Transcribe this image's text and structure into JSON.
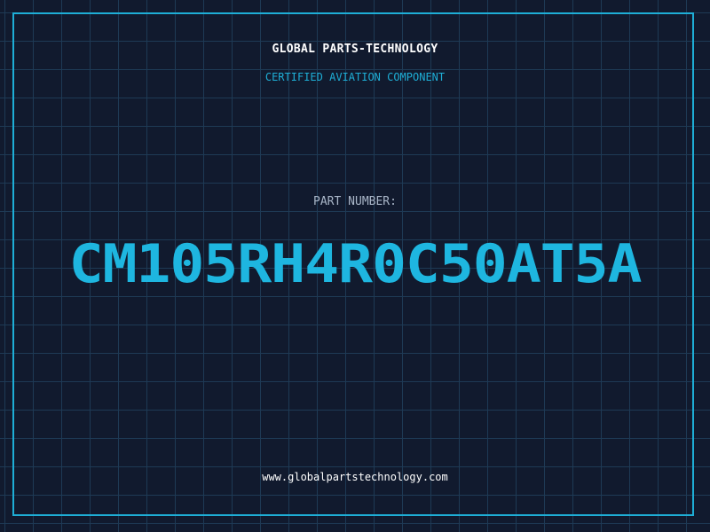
{
  "header": {
    "brand": "GLOBAL PARTS-TECHNOLOGY",
    "subtitle": "CERTIFIED AVIATION COMPONENT"
  },
  "part": {
    "label": "PART NUMBER:",
    "number": "CM105RH4R0C50AT5A"
  },
  "footer": {
    "url": "www.globalpartstechnology.com"
  },
  "colors": {
    "background": "#111a2e",
    "grid": "#1e3a55",
    "accent": "#1eaed6",
    "part_number": "#1eb6e0"
  }
}
